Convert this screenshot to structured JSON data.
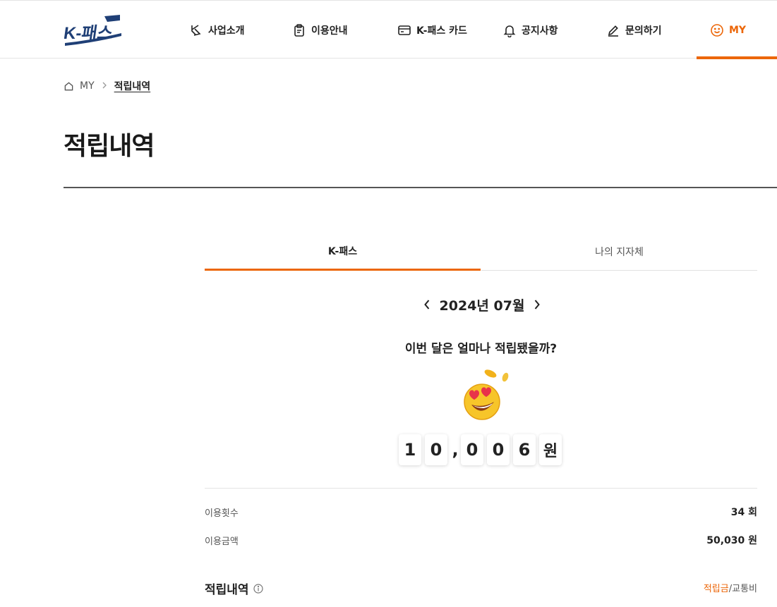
{
  "header": {
    "logo_text": "K-패스",
    "nav": [
      {
        "label": "사업소개",
        "icon": "k-logo-icon"
      },
      {
        "label": "이용안내",
        "icon": "clipboard-icon"
      },
      {
        "label": "K-패스 카드",
        "icon": "card-icon"
      },
      {
        "label": "공지사항",
        "icon": "bell-icon"
      },
      {
        "label": "문의하기",
        "icon": "pencil-icon"
      },
      {
        "label": "MY",
        "icon": "smile-icon",
        "active": true
      }
    ],
    "accent_color": "#ec6608"
  },
  "breadcrumb": {
    "home_icon": "home-icon",
    "items": [
      "MY",
      "적립내역"
    ]
  },
  "page": {
    "title": "적립내역"
  },
  "tabs": [
    {
      "label": "K-패스",
      "active": true
    },
    {
      "label": "나의 지자체",
      "active": false
    }
  ],
  "month_nav": {
    "label": "2024년 07월",
    "prev_icon": "chevron-left-icon",
    "next_icon": "chevron-right-icon"
  },
  "summary": {
    "question": "이번 달은 얼마나 적립됐을까?",
    "emoji": "heart-eyes-emoji",
    "digits": [
      "1",
      "0",
      "0",
      "0",
      "6"
    ],
    "comma": ",",
    "unit": "원"
  },
  "stats": [
    {
      "label": "이용횟수",
      "value": "34 회"
    },
    {
      "label": "이용금액",
      "value": "50,030 원"
    }
  ],
  "history": {
    "title": "적립내역",
    "legend_accent": "적립금",
    "legend_sep": "/",
    "legend_rest": "교통비"
  }
}
